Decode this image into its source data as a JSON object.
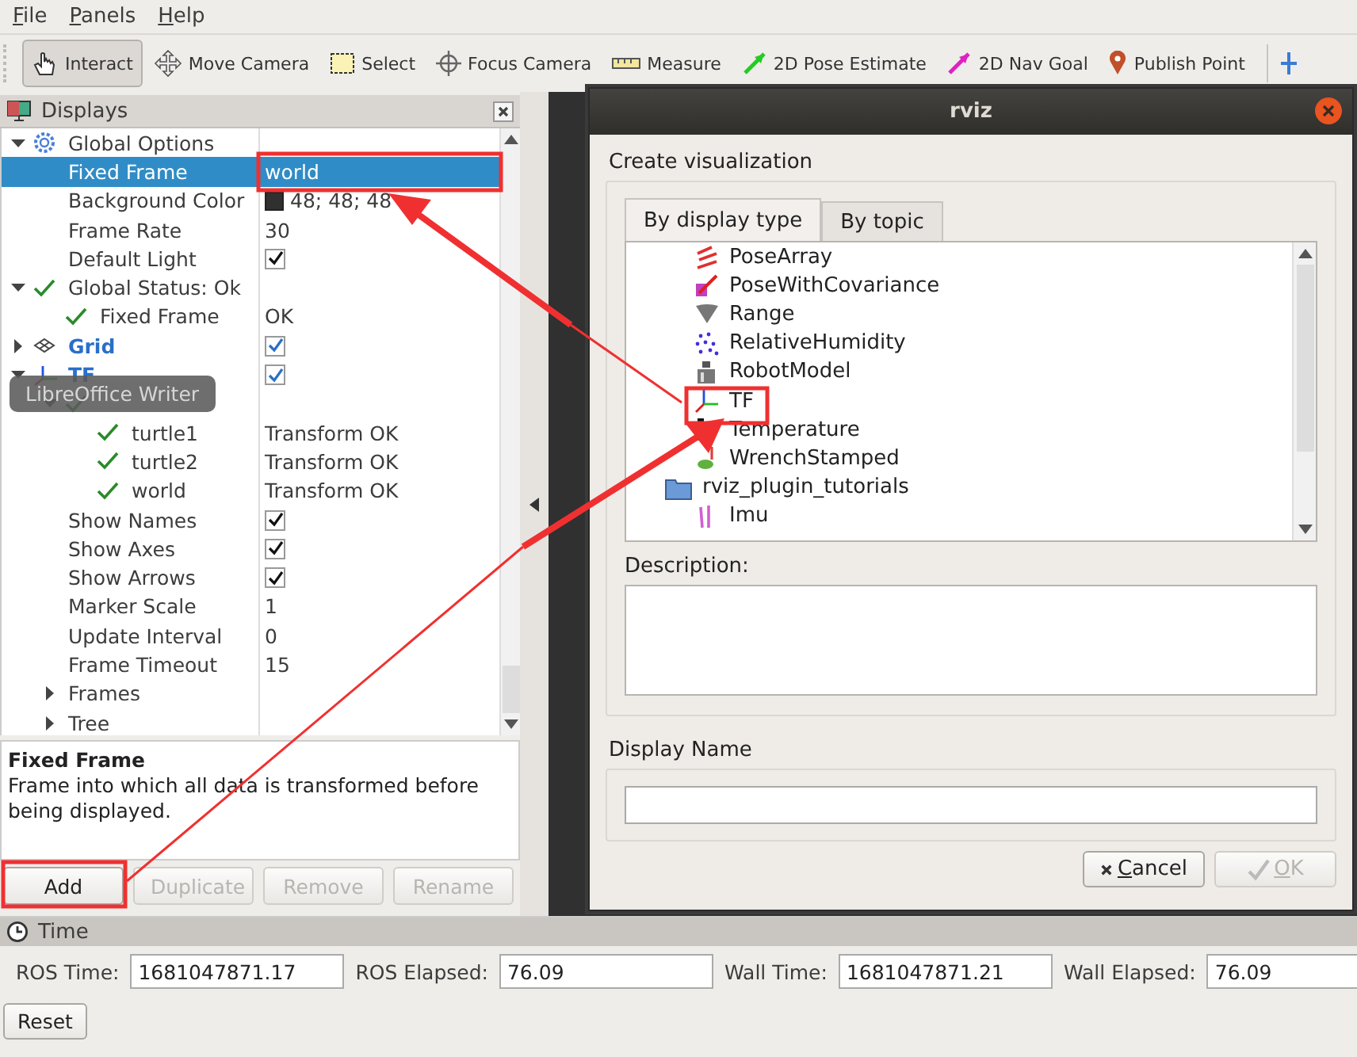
{
  "menu": [
    {
      "label": "File"
    },
    {
      "label": "Panels"
    },
    {
      "label": "Help"
    }
  ],
  "toolbar": [
    {
      "label": "Interact",
      "kind": "interact",
      "selected": true
    },
    {
      "label": "Move Camera",
      "kind": "move",
      "selected": false
    },
    {
      "label": "Select",
      "kind": "select",
      "selected": false
    },
    {
      "label": "Focus Camera",
      "kind": "focus",
      "selected": false
    },
    {
      "label": "Measure",
      "kind": "measure",
      "selected": false
    },
    {
      "label": "2D Pose Estimate",
      "kind": "pose",
      "selected": false
    },
    {
      "label": "2D Nav Goal",
      "kind": "goal",
      "selected": false
    },
    {
      "label": "Publish Point",
      "kind": "point",
      "selected": false
    }
  ],
  "displays": {
    "title": "Displays",
    "tree": [
      {
        "name": "Global Options",
        "kind": "options",
        "expanded": true,
        "selected": false,
        "children": [
          {
            "name": "Fixed Frame",
            "kind": "property",
            "selected": true,
            "value": {
              "kind": "text",
              "text": "world"
            }
          },
          {
            "name": "Background Color",
            "kind": "property",
            "selected": false,
            "value": {
              "kind": "color",
              "color": "#303030",
              "text": "48; 48; 48"
            }
          },
          {
            "name": "Frame Rate",
            "kind": "property",
            "selected": false,
            "value": {
              "kind": "text",
              "text": "30"
            }
          },
          {
            "name": "Default Light",
            "kind": "property",
            "selected": false,
            "value": {
              "kind": "checkbox",
              "checked": true
            }
          }
        ]
      },
      {
        "name": "Global Status: Ok",
        "kind": "status",
        "expanded": true,
        "selected": false,
        "children": [
          {
            "name": "Fixed Frame",
            "kind": "status",
            "selected": false,
            "value": {
              "kind": "text",
              "text": "OK"
            }
          }
        ]
      },
      {
        "name": "Grid",
        "kind": "grid",
        "expanded": false,
        "selected": false,
        "value": {
          "kind": "checkbox",
          "checked": true
        }
      },
      {
        "name": "TF",
        "kind": "tf",
        "expanded": true,
        "selected": false,
        "value": {
          "kind": "checkbox",
          "checked": true
        },
        "children": [
          {
            "kind": "status",
            "expanded": true,
            "selected": false,
            "children": [
              {
                "name": "turtle1",
                "kind": "status",
                "selected": false,
                "value": {
                  "kind": "text",
                  "text": "Transform OK"
                }
              },
              {
                "name": "turtle2",
                "kind": "status",
                "selected": false,
                "value": {
                  "kind": "text",
                  "text": "Transform OK"
                }
              },
              {
                "name": "world",
                "kind": "status",
                "selected": false,
                "value": {
                  "kind": "text",
                  "text": "Transform OK"
                }
              }
            ]
          },
          {
            "name": "Show Names",
            "kind": "property",
            "selected": false,
            "value": {
              "kind": "checkbox",
              "checked": true
            }
          },
          {
            "name": "Show Axes",
            "kind": "property",
            "selected": false,
            "value": {
              "kind": "checkbox",
              "checked": true
            }
          },
          {
            "name": "Show Arrows",
            "kind": "property",
            "selected": false,
            "value": {
              "kind": "checkbox",
              "checked": true
            }
          },
          {
            "name": "Marker Scale",
            "kind": "property",
            "selected": false,
            "value": {
              "kind": "text",
              "text": "1"
            }
          },
          {
            "name": "Update Interval",
            "kind": "property",
            "selected": false,
            "value": {
              "kind": "text",
              "text": "0"
            }
          },
          {
            "name": "Frame Timeout",
            "kind": "property",
            "selected": false,
            "value": {
              "kind": "text",
              "text": "15"
            }
          },
          {
            "name": "Frames",
            "kind": "property",
            "expanded": false,
            "selected": false
          },
          {
            "name": "Tree",
            "kind": "property",
            "expanded": false,
            "selected": false
          }
        ]
      }
    ],
    "description": {
      "title": "Fixed Frame",
      "text": "Frame into which all data is transformed before being displayed."
    },
    "buttons": [
      {
        "label": "Add",
        "disabled": false
      },
      {
        "label": "Duplicate",
        "disabled": true
      },
      {
        "label": "Remove",
        "disabled": true
      },
      {
        "label": "Rename",
        "disabled": true
      }
    ]
  },
  "tooltip": "LibreOffice Writer",
  "dialog": {
    "title": "rviz",
    "heading": "Create visualization",
    "tabs": [
      {
        "label": "By display type",
        "selected": true
      },
      {
        "label": "By topic",
        "selected": false
      }
    ],
    "items": [
      {
        "name": "PoseArray",
        "kind": "posearray",
        "selected": false
      },
      {
        "name": "PoseWithCovariance",
        "kind": "posecov",
        "selected": false
      },
      {
        "name": "Range",
        "kind": "range",
        "selected": false
      },
      {
        "name": "RelativeHumidity",
        "kind": "humidity",
        "selected": false
      },
      {
        "name": "RobotModel",
        "kind": "robot",
        "selected": false
      },
      {
        "name": "TF",
        "kind": "tf",
        "selected": false
      },
      {
        "name": "Temperature",
        "kind": "temperature",
        "selected": false
      },
      {
        "name": "WrenchStamped",
        "kind": "wrench",
        "selected": false
      },
      {
        "name": "rviz_plugin_tutorials",
        "kind": "folder",
        "selected": false,
        "children": [
          {
            "name": "Imu",
            "kind": "imu",
            "selected": false
          }
        ]
      }
    ],
    "description_label": "Description:",
    "name_label": "Display Name",
    "buttons": [
      {
        "label": "Cancel",
        "kind": "cancel",
        "disabled": false
      },
      {
        "label": "OK",
        "kind": "ok",
        "disabled": true
      }
    ]
  },
  "time": {
    "title": "Time",
    "fields": [
      {
        "label": "ROS Time:",
        "value": "1681047871.17"
      },
      {
        "label": "ROS Elapsed:",
        "value": "76.09"
      },
      {
        "label": "Wall Time:",
        "value": "1681047871.21"
      },
      {
        "label": "Wall Elapsed:",
        "value": "76.09"
      }
    ],
    "reset": "Reset"
  }
}
